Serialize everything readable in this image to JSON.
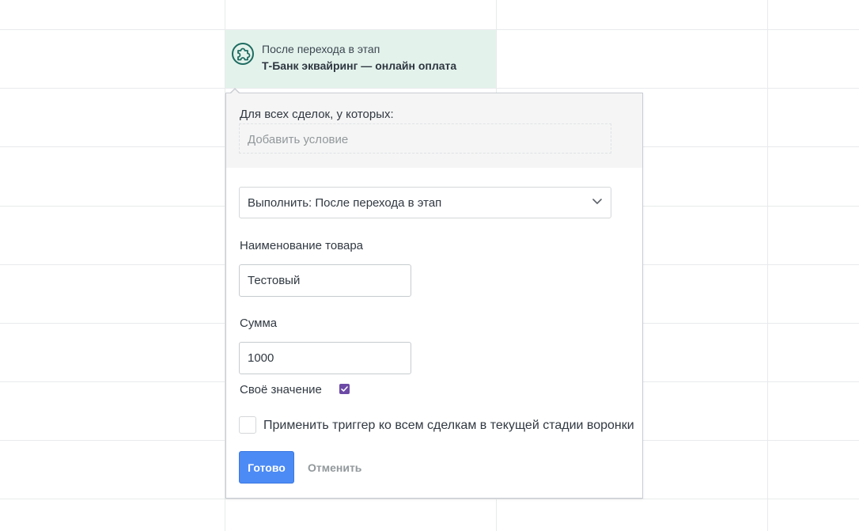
{
  "trigger": {
    "subtitle": "После перехода в этап",
    "title": "Т-Банк эквайринг — онлайн оплата",
    "icon": "puzzle-icon",
    "accent": "#1e6b60",
    "background": "#e3f3ec"
  },
  "popup": {
    "conditions_label": "Для всех сделок, у которых:",
    "add_condition": "Добавить условие",
    "execute_select": "Выполнить: После перехода в этап",
    "product_name_label": "Наименование товара",
    "product_name_value": "Тестовый",
    "amount_label": "Сумма",
    "amount_value": "1000",
    "own_value_label": "Своё значение",
    "own_value_checked": true,
    "apply_label": "Применить триггер ко всем сделкам в текущей стадии воронки",
    "apply_checked": false,
    "done_button": "Готово",
    "cancel_button": "Отменить"
  },
  "colors": {
    "primary_button": "#4c8bf5",
    "checkbox_checked": "#6c4aa6",
    "muted_text": "#92989b"
  }
}
